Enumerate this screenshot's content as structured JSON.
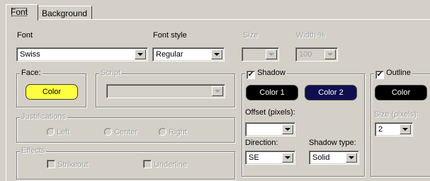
{
  "tabs": {
    "font": "Font",
    "background": "Background"
  },
  "font": {
    "label": "Font",
    "value": "Swiss",
    "style_label": "Font style",
    "style_value": "Regular",
    "size_label": "Size",
    "size_value": "",
    "width_label": "Width %",
    "width_value": "100"
  },
  "face": {
    "title": "Face:",
    "color_label": "Color",
    "color": "#ffff40"
  },
  "script": {
    "title": "Script",
    "value": ""
  },
  "justifications": {
    "title": "Justifications",
    "left": "Left",
    "center": "Center",
    "right": "Right"
  },
  "effects": {
    "title": "Effects",
    "strikeout": "Strikeout",
    "underline": "Underline"
  },
  "shadow": {
    "title": "Shadow",
    "checked": "✔",
    "color1_label": "Color 1",
    "color1": "#000000",
    "color2_label": "Color 2",
    "color2": "#0f0f50",
    "offset_label": "Offset (pixels):",
    "offset_value": "",
    "direction_label": "Direction:",
    "direction_value": "SE",
    "type_label": "Shadow type:",
    "type_value": "Solid"
  },
  "outline": {
    "title": "Outline",
    "checked": "✔",
    "color_label": "Color",
    "color": "#000000",
    "size_label": "Size (pixels):",
    "size_value": "2"
  }
}
